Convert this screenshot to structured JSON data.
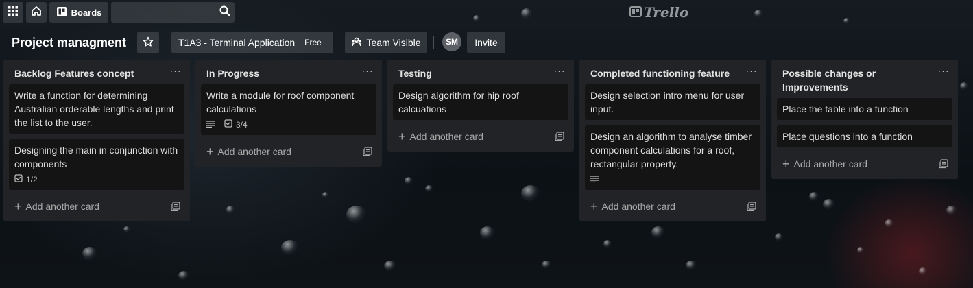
{
  "nav": {
    "boards_label": "Boards",
    "search_placeholder": "",
    "logo_text": "Trello"
  },
  "board": {
    "title": "Project managment",
    "workspace_name": "T1A3 - Terminal Application",
    "workspace_badge": "Free",
    "visibility_label": "Team Visible",
    "member_initials": "SM",
    "invite_label": "Invite"
  },
  "lists": [
    {
      "title": "Backlog Features concept",
      "more": "···",
      "cards": [
        {
          "title": "Write a function for determining Australian orderable lengths and print the list to the user."
        },
        {
          "title": "Designing the main in conjunction with components",
          "checklist": "1/2"
        }
      ],
      "add_label": "Add another card"
    },
    {
      "title": "In Progress",
      "more": "···",
      "cards": [
        {
          "title": "Write a module for roof component calculations",
          "description": true,
          "checklist": "3/4"
        }
      ],
      "add_label": "Add another card"
    },
    {
      "title": "Testing",
      "more": "···",
      "cards": [
        {
          "title": "Design algorithm for hip roof calcuations"
        }
      ],
      "add_label": "Add another card"
    },
    {
      "title": "Completed functioning feature",
      "more": "···",
      "cards": [
        {
          "title": "Design selection intro menu for user input."
        },
        {
          "title": "Design an algorithm to analyse timber component calculations for a roof, rectangular property.",
          "description": true
        }
      ],
      "add_label": "Add another card"
    },
    {
      "title": "Possible changes or Improvements",
      "more": "···",
      "cards": [
        {
          "title": "Place the table into a function"
        },
        {
          "title": "Place questions into a function"
        }
      ],
      "add_label": "Add another card"
    }
  ]
}
